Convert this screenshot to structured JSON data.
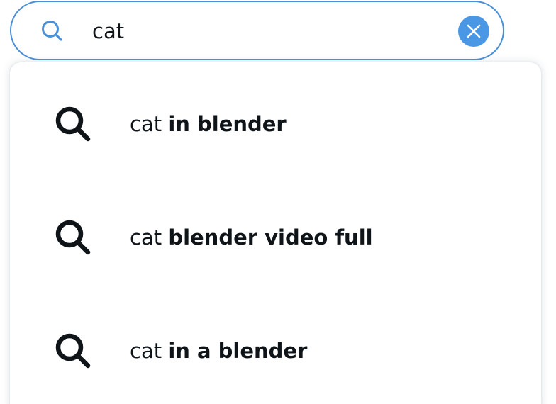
{
  "search": {
    "query": "cat"
  },
  "suggestions": [
    {
      "typed": "cat",
      "completion": "in blender"
    },
    {
      "typed": "cat",
      "completion": "blender video full"
    },
    {
      "typed": "cat",
      "completion": "in a blender"
    }
  ],
  "icons": {
    "search_field": "search-icon",
    "clear": "close-icon",
    "suggestion": "search-icon"
  },
  "colors": {
    "accent": "#4a90d9",
    "clear_button": "#4a97e6",
    "text": "#0f1419"
  }
}
